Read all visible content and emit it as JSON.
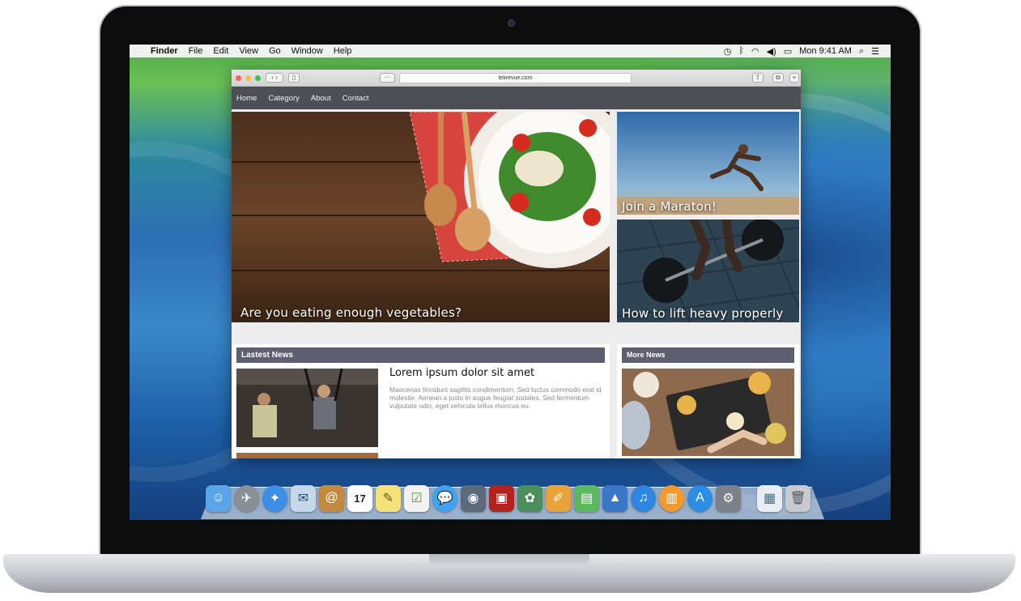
{
  "menubar": {
    "apple": "",
    "app": "Finder",
    "menus": [
      "File",
      "Edit",
      "View",
      "Go",
      "Window",
      "Help"
    ],
    "clock": "Mon 9:41 AM"
  },
  "browser": {
    "url": "tekrevue.com"
  },
  "site": {
    "nav": [
      "Home",
      "Category",
      "About",
      "Contact"
    ],
    "hero_caption": "Are you eating enough vegetables?",
    "side_captions": [
      "Join a Maraton!",
      "How to lift heavy properly"
    ],
    "latest_heading": "Lastest News",
    "more_heading": "More News",
    "article": {
      "title": "Lorem ipsum dolor sit amet",
      "body": "Maecenas tincidunt sagittis condimentum. Sed luctus commodo erat id molestie. Aenean a justo in augue feugiat sodales. Sed fermentum vulputate odio, eget vehicula tellus rhoncus eu."
    }
  },
  "dock": {
    "calendar_day": "17",
    "apps": [
      "finder-icon",
      "launchpad-icon",
      "safari-icon",
      "mail-icon",
      "contacts-icon",
      "calendar-icon",
      "notes-icon",
      "reminders-icon",
      "messages-icon",
      "facetime-icon",
      "photo-booth-icon",
      "iphoto-icon",
      "pages-icon",
      "numbers-icon",
      "keynote-icon",
      "itunes-icon",
      "ibooks-icon",
      "app-store-icon",
      "system-preferences-icon",
      "preview-icon",
      "trash-icon"
    ]
  }
}
